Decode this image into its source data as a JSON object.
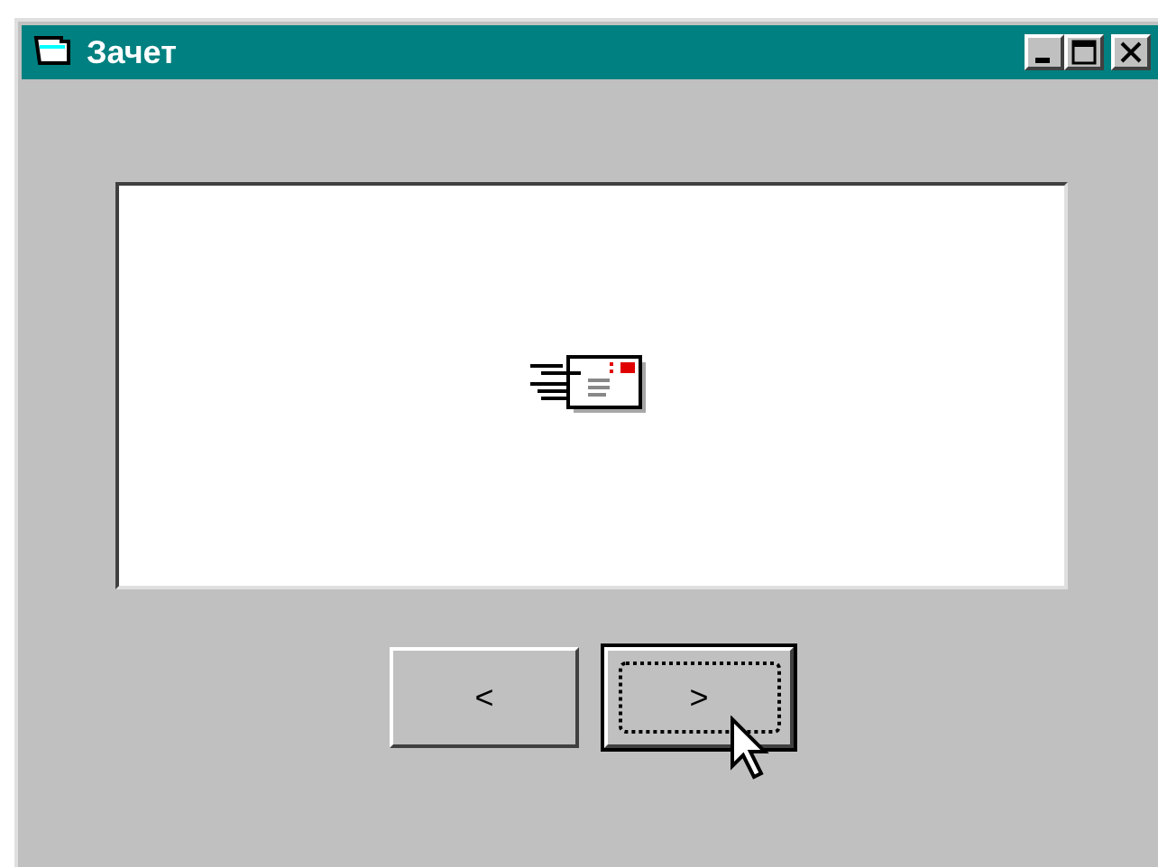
{
  "window": {
    "title": "Зачет"
  },
  "buttons": [
    {
      "label": "<",
      "focused": false
    },
    {
      "label": ">",
      "focused": true
    }
  ]
}
